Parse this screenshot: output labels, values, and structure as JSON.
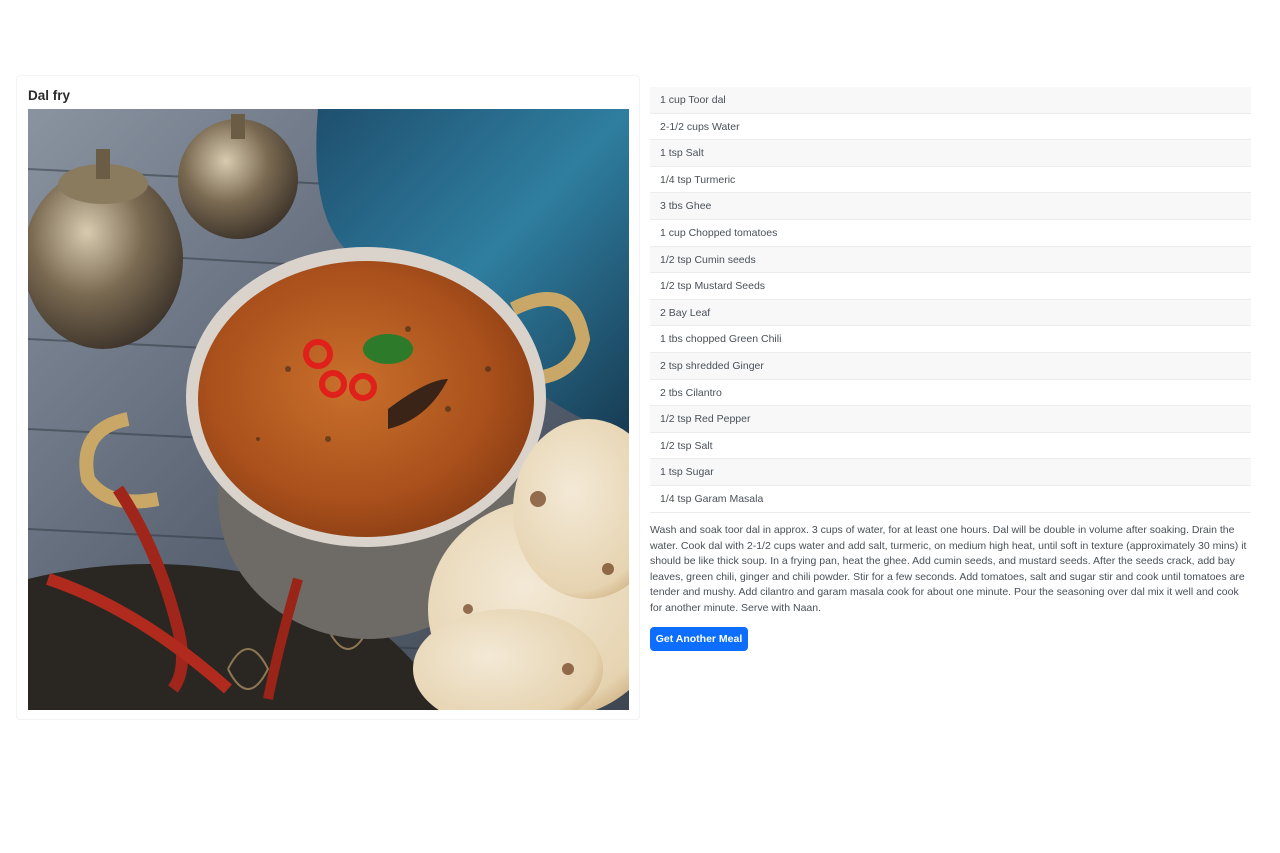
{
  "meal": {
    "title": "Dal fry",
    "image_alt": "Dal fry"
  },
  "ingredients": [
    "1 cup Toor dal",
    "2-1/2 cups Water",
    "1 tsp Salt",
    "1/4 tsp Turmeric",
    "3 tbs Ghee",
    "1 cup Chopped tomatoes",
    "1/2 tsp Cumin seeds",
    "1/2 tsp Mustard Seeds",
    "2 Bay Leaf",
    "1 tbs chopped Green Chili",
    "2 tsp shredded Ginger",
    "2 tbs  Cilantro",
    "1/2 tsp Red Pepper",
    "1/2 tsp Salt",
    "1 tsp Sugar",
    "1/4 tsp Garam Masala"
  ],
  "instructions": "Wash and soak toor dal in approx. 3 cups of water, for at least one hours. Dal will be double in volume after soaking. Drain the water. Cook dal with 2-1/2 cups water and add salt, turmeric, on medium high heat, until soft in texture (approximately 30 mins) it should be like thick soup. In a frying pan, heat the ghee. Add cumin seeds, and mustard seeds. After the seeds crack, add bay leaves, green chili, ginger and chili powder. Stir for a few seconds. Add tomatoes, salt and sugar stir and cook until tomatoes are tender and mushy. Add cilantro and garam masala cook for about one minute. Pour the seasoning over dal mix it well and cook for another minute. Serve with Naan.",
  "actions": {
    "get_another_label": "Get Another Meal",
    "primary_color": "#0d6efd"
  }
}
